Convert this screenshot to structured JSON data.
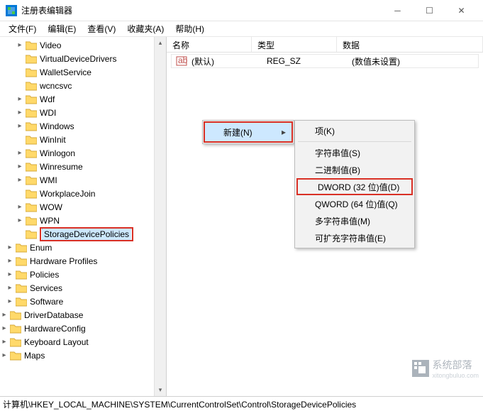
{
  "window": {
    "title": "注册表编辑器"
  },
  "menu": {
    "file": "文件(F)",
    "edit": "编辑(E)",
    "view": "查看(V)",
    "favorites": "收藏夹(A)",
    "help": "帮助(H)"
  },
  "tree": {
    "items": [
      "Video",
      "VirtualDeviceDrivers",
      "WalletService",
      "wcncsvc",
      "Wdf",
      "WDI",
      "Windows",
      "WinInit",
      "Winlogon",
      "Winresume",
      "WMI",
      "WorkplaceJoin",
      "WOW",
      "WPN",
      "StorageDevicePolicies"
    ],
    "lower": [
      "Enum",
      "Hardware Profiles",
      "Policies",
      "Services",
      "Software"
    ],
    "lower2": [
      "DriverDatabase",
      "HardwareConfig",
      "Keyboard Layout",
      "Maps"
    ]
  },
  "columns": {
    "name": "名称",
    "type": "类型",
    "data": "数据"
  },
  "listrow": {
    "name": "(默认)",
    "type": "REG_SZ",
    "data": "(数值未设置)"
  },
  "context": {
    "new": "新建(N)"
  },
  "submenu": {
    "key": "项(K)",
    "string": "字符串值(S)",
    "binary": "二进制值(B)",
    "dword": "DWORD (32 位)值(D)",
    "qword": "QWORD (64 位)值(Q)",
    "multi": "多字符串值(M)",
    "expand": "可扩充字符串值(E)"
  },
  "status": {
    "path": "计算机\\HKEY_LOCAL_MACHINE\\SYSTEM\\CurrentControlSet\\Control\\StorageDevicePolicies"
  },
  "watermark": {
    "text": "系统部落",
    "sub": "xitongbuluo.com"
  }
}
